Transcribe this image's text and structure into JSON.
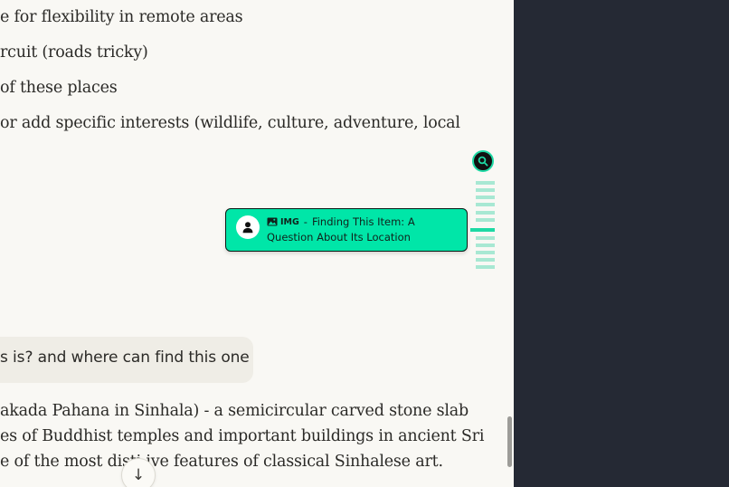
{
  "chat": {
    "lines": [
      "e for flexibility in remote areas",
      "rcuit (roads tricky)",
      "of these places",
      " or add specific interests (wildlife, culture, adventure, local"
    ],
    "user_message": "s is? and where can find this one",
    "response_lines": [
      "akada Pahana in Sinhala) - a semicircular carved stone slab",
      "es of Buddhist temples and important buildings in ancient Sri",
      "e of the most disti    ive features of classical Sinhalese art."
    ],
    "scroll_down_icon": "↓"
  },
  "navigator": {
    "search_icon": "search-icon",
    "tooltip": {
      "tag": "IMG",
      "separator": "-",
      "title_line1": "Finding This Item: A",
      "title_line2": "Question About Its Location"
    }
  },
  "colors": {
    "accent": "#00e6a8",
    "side_panel": "#252934",
    "chat_bg": "#f9f8f4"
  }
}
